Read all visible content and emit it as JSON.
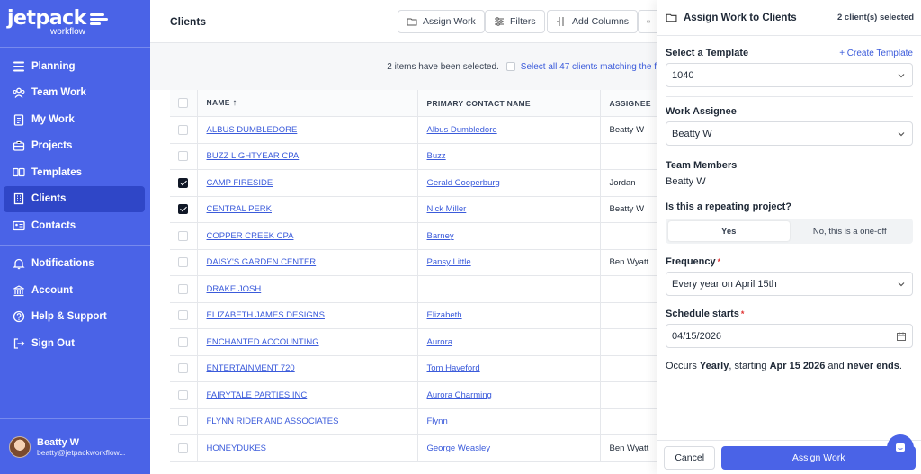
{
  "app": {
    "logo_word": "jetpack",
    "logo_sub": "workflow"
  },
  "sidebar": {
    "items": [
      {
        "label": "Planning",
        "icon": "dashboard-icon"
      },
      {
        "label": "Team Work",
        "icon": "team-icon"
      },
      {
        "label": "My Work",
        "icon": "clipboard-icon"
      },
      {
        "label": "Projects",
        "icon": "briefcase-icon"
      },
      {
        "label": "Templates",
        "icon": "template-icon"
      },
      {
        "label": "Clients",
        "icon": "building-icon",
        "active": true
      },
      {
        "label": "Contacts",
        "icon": "contact-card-icon"
      }
    ],
    "bottom_items": [
      {
        "label": "Notifications",
        "icon": "bell-icon"
      },
      {
        "label": "Account",
        "icon": "bank-icon"
      },
      {
        "label": "Help & Support",
        "icon": "help-icon"
      },
      {
        "label": "Sign Out",
        "icon": "sign-out-icon"
      }
    ],
    "user": {
      "name": "Beatty W",
      "email": "beatty@jetpackworkflow..."
    }
  },
  "main": {
    "title": "Clients",
    "toolbar": {
      "assign_work": "Assign Work",
      "filters": "Filters",
      "add_columns": "Add Columns"
    },
    "selection": {
      "text": "2 items have been selected.",
      "select_all": "Select all 47 clients matching the f"
    },
    "columns": [
      "NAME",
      "PRIMARY CONTACT NAME",
      "ASSIGNEE"
    ],
    "rows": [
      {
        "name": "ALBUS DUMBLEDORE",
        "contact": "Albus Dumbledore",
        "assignee": "Beatty W",
        "checked": false
      },
      {
        "name": "BUZZ LIGHTYEAR CPA",
        "contact": "Buzz",
        "assignee": "",
        "checked": false
      },
      {
        "name": "CAMP FIRESIDE",
        "contact": "Gerald Cooperburg",
        "assignee": "Jordan",
        "checked": true
      },
      {
        "name": "CENTRAL PERK",
        "contact": "Nick Miller",
        "assignee": "Beatty W",
        "checked": true
      },
      {
        "name": "COPPER CREEK CPA",
        "contact": "Barney",
        "assignee": "",
        "checked": false
      },
      {
        "name": "DAISY'S GARDEN CENTER",
        "contact": "Pansy Little",
        "assignee": "Ben Wyatt",
        "checked": false
      },
      {
        "name": "DRAKE JOSH",
        "contact": "",
        "assignee": "",
        "checked": false
      },
      {
        "name": "ELIZABETH JAMES DESIGNS",
        "contact": "Elizabeth",
        "assignee": "",
        "checked": false
      },
      {
        "name": "ENCHANTED ACCOUNTING",
        "contact": "Aurora",
        "assignee": "",
        "checked": false
      },
      {
        "name": "ENTERTAINMENT 720",
        "contact": "Tom Haveford",
        "assignee": "",
        "checked": false
      },
      {
        "name": "FAIRYTALE PARTIES INC",
        "contact": "Aurora Charming",
        "assignee": "",
        "checked": false
      },
      {
        "name": "FLYNN RIDER AND ASSOCIATES",
        "contact": "Flynn",
        "assignee": "",
        "checked": false
      },
      {
        "name": "HONEYDUKES",
        "contact": "George Weasley",
        "assignee": "Ben Wyatt",
        "checked": false
      }
    ]
  },
  "panel": {
    "title": "Assign Work to Clients",
    "count": "2 client(s) selected",
    "template_label": "Select a Template",
    "create_template": "+ Create Template",
    "template_value": "1040",
    "assignee_label": "Work Assignee",
    "assignee_value": "Beatty W",
    "team_label": "Team Members",
    "team_value": "Beatty W",
    "repeat_label": "Is this a repeating project?",
    "repeat_yes": "Yes",
    "repeat_no": "No, this is a one-off",
    "frequency_label": "Frequency",
    "frequency_value": "Every year on April 15th",
    "schedule_label": "Schedule starts",
    "schedule_value": "04/15/2026",
    "occurs": {
      "pre": "Occurs ",
      "freq": "Yearly",
      "mid": ", starting ",
      "date": "Apr 15 2026",
      "and": " and ",
      "end": "never ends",
      "dot": "."
    },
    "cancel": "Cancel",
    "assign": "Assign Work"
  },
  "colors": {
    "brand": "#4a63e7",
    "active_nav": "#2f46c7",
    "link": "#3b5bdb"
  }
}
